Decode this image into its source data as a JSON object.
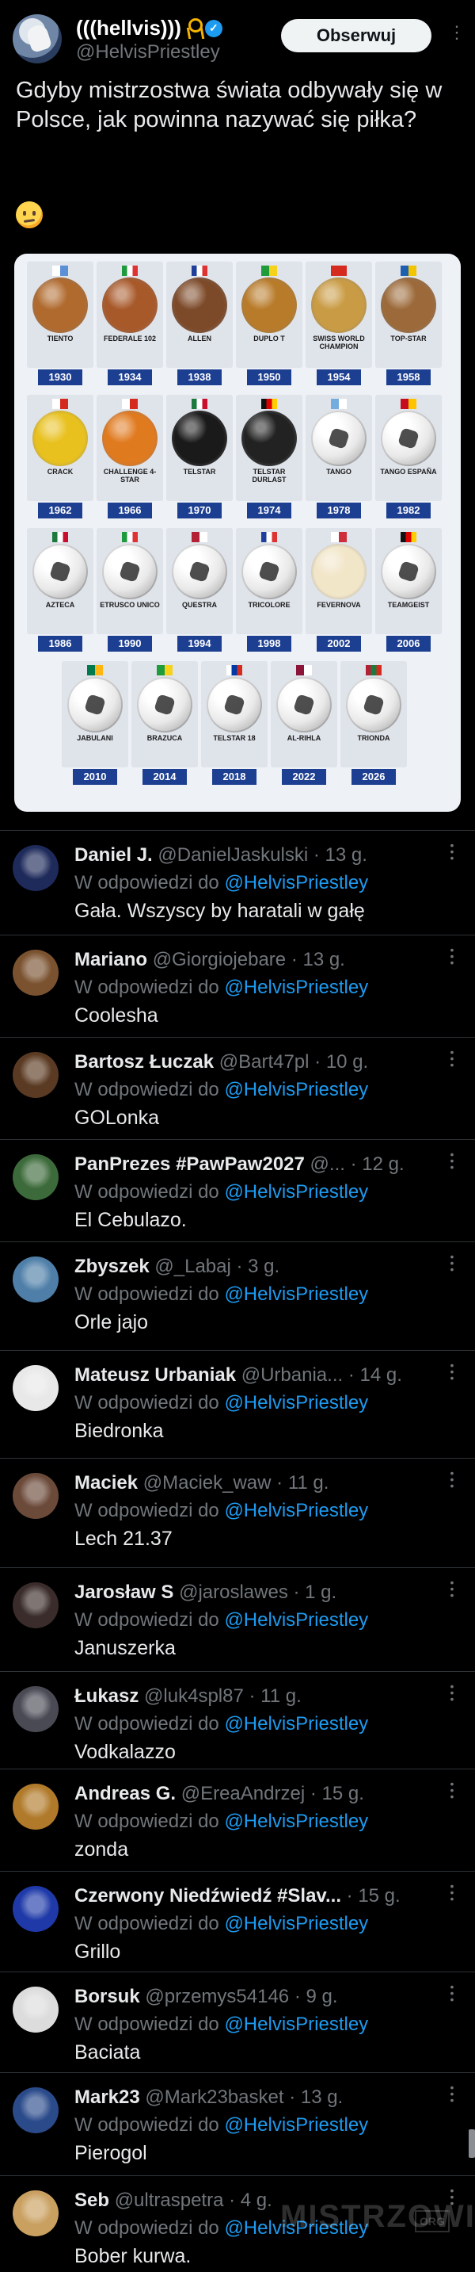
{
  "tweet": {
    "display_name": "(((hellvis)))",
    "handle": "@HelvisPriestley",
    "follow_label": "Obserwuj",
    "text": "Gdyby mistrzostwa świata odbywały się w Polsce, jak powinna nazywać się piłka?",
    "emoji": "thinking-face-emoji",
    "accent": "#1d9bf0"
  },
  "balls": [
    {
      "name": "TIENTO",
      "year": "1930",
      "flag": "uruguay-flag",
      "color": "#b06a2e"
    },
    {
      "name": "FEDERALE 102",
      "year": "1934",
      "flag": "italy-flag",
      "color": "#a8592a"
    },
    {
      "name": "ALLEN",
      "year": "1938",
      "flag": "france-flag",
      "color": "#7d4a29"
    },
    {
      "name": "DUPLO T",
      "year": "1950",
      "flag": "brazil-flag",
      "color": "#b87b2a"
    },
    {
      "name": "SWISS WORLD CHAMPION",
      "year": "1954",
      "flag": "switzerland-flag",
      "color": "#c99b44"
    },
    {
      "name": "TOP-STAR",
      "year": "1958",
      "flag": "sweden-flag",
      "color": "#9c6a3a"
    },
    {
      "name": "CRACK",
      "year": "1962",
      "flag": "chile-flag",
      "color": "#e8c11f"
    },
    {
      "name": "CHALLENGE 4-STAR",
      "year": "1966",
      "flag": "england-flag",
      "color": "#e07a1f"
    },
    {
      "name": "TELSTAR",
      "year": "1970",
      "flag": "mexico-flag",
      "color": "#1a1a1a"
    },
    {
      "name": "TELSTAR DURLAST",
      "year": "1974",
      "flag": "germany-flag",
      "color": "#222222"
    },
    {
      "name": "TANGO",
      "year": "1978",
      "flag": "argentina-flag",
      "color": "#ffffff"
    },
    {
      "name": "TANGO ESPAÑA",
      "year": "1982",
      "flag": "spain-flag",
      "color": "#ffffff"
    },
    {
      "name": "AZTECA",
      "year": "1986",
      "flag": "mexico-flag",
      "color": "#ffffff"
    },
    {
      "name": "ETRUSCO UNICO",
      "year": "1990",
      "flag": "italy-flag",
      "color": "#ffffff"
    },
    {
      "name": "QUESTRA",
      "year": "1994",
      "flag": "usa-flag",
      "color": "#ffffff"
    },
    {
      "name": "TRICOLORE",
      "year": "1998",
      "flag": "france-flag",
      "color": "#ffffff"
    },
    {
      "name": "FEVERNOVA",
      "year": "2002",
      "flag": "korea-japan-flag",
      "color": "#f2e6c9"
    },
    {
      "name": "TEAMGEIST",
      "year": "2006",
      "flag": "germany-flag",
      "color": "#ffffff"
    },
    {
      "name": "JABULANI",
      "year": "2010",
      "flag": "south-africa-flag",
      "color": "#ffffff"
    },
    {
      "name": "BRAZUCA",
      "year": "2014",
      "flag": "brazil-flag",
      "color": "#ffffff"
    },
    {
      "name": "TELSTAR 18",
      "year": "2018",
      "flag": "russia-flag",
      "color": "#ffffff"
    },
    {
      "name": "AL-RIHLA",
      "year": "2022",
      "flag": "qatar-flag",
      "color": "#ffffff"
    },
    {
      "name": "TRIONDA",
      "year": "2026",
      "flag": "usa-mexico-canada-flag",
      "color": "#ffffff"
    }
  ],
  "replying_prefix": "W odpowiedzi do",
  "replying_to": "@HelvisPriestley",
  "replies": [
    {
      "name": "Daniel J.",
      "handle": "@DanielJaskulski",
      "time": "· 13 g.",
      "text": "Gała. Wszyscy by haratali w gałę",
      "avatar": "space-avatar",
      "avatar_color": "#1e2a5a"
    },
    {
      "name": "Mariano",
      "handle": "@Giorgiojebare",
      "time": "· 13 g.",
      "text": "Coolesha",
      "avatar": "photo-avatar",
      "avatar_color": "#7a5230"
    },
    {
      "name": "Bartosz Łuczak",
      "handle": "@Bart47pl",
      "time": "· 10 g.",
      "text": "GOLonka",
      "avatar": "face-avatar",
      "avatar_color": "#5a3a22"
    },
    {
      "name": "PanPrezes #PawPaw2027",
      "handle": "@...",
      "time": "· 12 g.",
      "text": "El Cebulazo.",
      "avatar": "face-avatar",
      "avatar_color": "#3c6a3a"
    },
    {
      "name": "Zbyszek",
      "handle": "@_Labaj",
      "time": "· 3 g.",
      "text": "Orle jajo",
      "avatar": "landscape-avatar",
      "avatar_color": "#4f7fa8"
    },
    {
      "name": "Mateusz Urbaniak",
      "handle": "@Urbania...",
      "time": "· 14 g.",
      "text": "Biedronka",
      "avatar": "sketch-avatar",
      "avatar_color": "#e8e8e8"
    },
    {
      "name": "Maciek",
      "handle": "@Maciek_waw",
      "time": "· 11 g.",
      "text": "Lech 21.37",
      "avatar": "face-avatar",
      "avatar_color": "#6b4a3a"
    },
    {
      "name": "Jarosław S",
      "handle": "@jaroslawes",
      "time": "· 1 g.",
      "text": "Januszerka",
      "avatar": "face-avatar",
      "avatar_color": "#3a2c2a"
    },
    {
      "name": "Łukasz",
      "handle": "@luk4spl87",
      "time": "· 11 g.",
      "text": "Vodkalazzo",
      "avatar": "face-avatar",
      "avatar_color": "#4a4a55"
    },
    {
      "name": "Andreas G.",
      "handle": "@EreaAndrzej",
      "time": "· 15 g.",
      "text": "zonda",
      "avatar": "icon-avatar",
      "avatar_color": "#b07a2a"
    },
    {
      "name": "Czerwony Niedźwiedź #Slav...",
      "handle": "",
      "time": "· 15 g.",
      "text": "Grillo",
      "avatar": "eu-flag-avatar",
      "avatar_color": "#1f3aa8"
    },
    {
      "name": "Borsuk",
      "handle": "@przemys54146",
      "time": "· 9 g.",
      "text": "Baciata",
      "avatar": "badger-avatar",
      "avatar_color": "#dcdcdc"
    },
    {
      "name": "Mark23",
      "handle": "@Mark23basket",
      "time": "· 13 g.",
      "text": "Pierogol",
      "avatar": "icon-avatar",
      "avatar_color": "#2a4a8a"
    },
    {
      "name": "Seb",
      "handle": "@ultraspetra",
      "time": "· 4 g.",
      "text": "Bober kurwa.",
      "avatar": "face-avatar",
      "avatar_color": "#c9a060"
    }
  ],
  "watermark": "MISTRZOWIE",
  "watermark_org": "ORG"
}
